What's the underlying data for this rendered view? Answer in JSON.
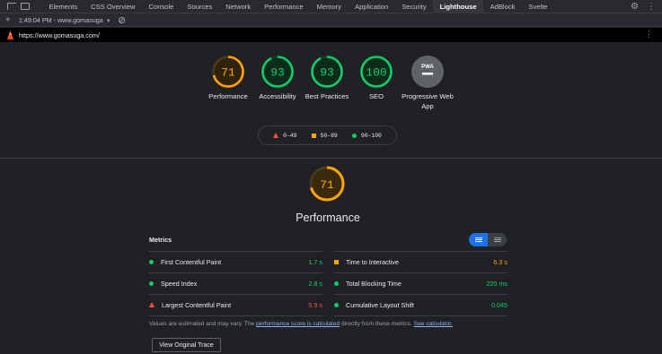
{
  "devtools": {
    "tabs": [
      "Elements",
      "CSS Overview",
      "Console",
      "Sources",
      "Network",
      "Performance",
      "Memory",
      "Application",
      "Security",
      "Lighthouse",
      "AdBlock",
      "Svelte"
    ],
    "active_tab": "Lighthouse"
  },
  "report_selector": "1:49:04 PM - www.gomasuga",
  "url": "https://www.gomasuga.com/",
  "categories": [
    {
      "label": "Performance",
      "score": "71",
      "status": "average",
      "color": "#ffa400",
      "fraction": 0.71
    },
    {
      "label": "Accessibility",
      "score": "93",
      "status": "pass",
      "color": "#0cce6b",
      "fraction": 0.93
    },
    {
      "label": "Best Practices",
      "score": "93",
      "status": "pass",
      "color": "#0cce6b",
      "fraction": 0.93
    },
    {
      "label": "SEO",
      "score": "100",
      "status": "pass",
      "color": "#0cce6b",
      "fraction": 1.0
    },
    {
      "label": "Progressive Web App",
      "badge": "PWA",
      "status": "neutral",
      "color": "#9aa0a6"
    }
  ],
  "legend": {
    "fail": "0–49",
    "average": "50–89",
    "pass": "90–100"
  },
  "performance": {
    "score": "71",
    "title": "Performance",
    "fraction": 0.71
  },
  "metrics": {
    "heading": "Metrics",
    "items": [
      {
        "name": "First Contentful Paint",
        "value": "1.7 s",
        "status": "pass"
      },
      {
        "name": "Time to Interactive",
        "value": "6.3 s",
        "status": "avg"
      },
      {
        "name": "Speed Index",
        "value": "2.8 s",
        "status": "pass"
      },
      {
        "name": "Total Blocking Time",
        "value": "220 ms",
        "status": "pass"
      },
      {
        "name": "Largest Contentful Paint",
        "value": "5.9 s",
        "status": "fail"
      },
      {
        "name": "Cumulative Layout Shift",
        "value": "0.045",
        "status": "pass"
      }
    ]
  },
  "note": {
    "before": "Values are estimated and may vary. The ",
    "link1": "performance score is calculated",
    "middle": " directly from these metrics. ",
    "link2": "See calculator."
  },
  "trace_button": "View Original Trace",
  "colors": {
    "pass": "#0cce6b",
    "average": "#ffa400",
    "fail": "#ff4e42",
    "accent": "#1a73e8"
  }
}
